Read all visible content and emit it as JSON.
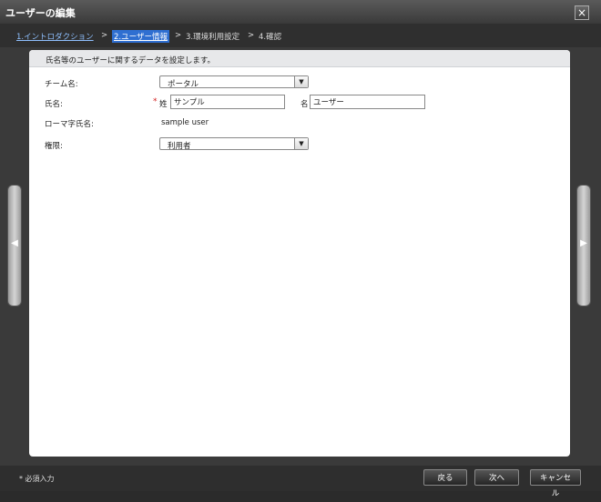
{
  "window": {
    "title": "ユーザーの編集",
    "close": "×"
  },
  "wizard": {
    "steps": [
      {
        "label": "1.イントロダクション",
        "state": "link"
      },
      {
        "label": "2.ユーザー情報",
        "state": "current"
      },
      {
        "label": "3.環境利用設定",
        "state": "normal"
      },
      {
        "label": "4.確認",
        "state": "normal"
      }
    ],
    "separator": ">"
  },
  "form": {
    "description": "氏名等のユーザーに関するデータを設定します。",
    "team": {
      "label": "チーム名:",
      "value": "ポータル"
    },
    "name": {
      "label": "氏名:",
      "required_mark": "*",
      "last_label": "姓",
      "last_value": "サンプル",
      "first_label": "名",
      "first_value": "ユーザー"
    },
    "romaji": {
      "label": "ローマ字氏名:",
      "value": "sample user"
    },
    "permission": {
      "label": "権限:",
      "value": "利用者"
    }
  },
  "footer": {
    "required_note": "* 必須入力",
    "back": "戻る",
    "next": "次へ",
    "cancel": "キャンセル"
  },
  "icons": {
    "dropdown": "▼",
    "prev": "◀",
    "next": "▶"
  }
}
